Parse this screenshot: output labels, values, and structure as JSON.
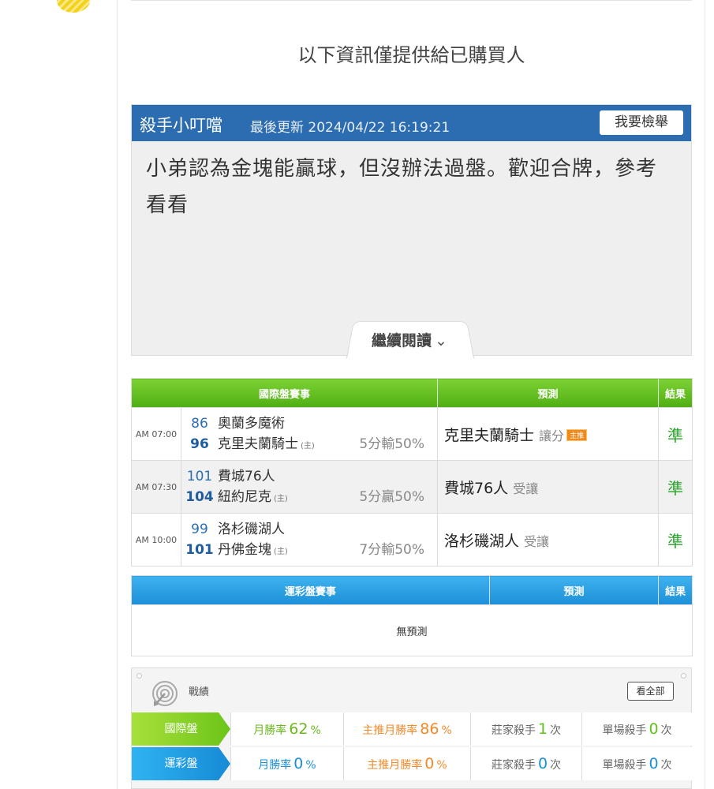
{
  "notice": "以下資訊僅提供給已購買人",
  "article": {
    "author": "殺手小叮噹",
    "updated": "最後更新 2024/04/22 16:19:21",
    "report_label": "我要檢舉",
    "body": "小弟認為金塊能贏球，但沒辦法過盤。歡迎合牌，參考看看",
    "read_more": "繼續閱讀"
  },
  "intl": {
    "headers": [
      "國際盤賽事",
      "預測",
      "結果"
    ],
    "home_mark": "(主)",
    "main_tag": "主推",
    "games": [
      {
        "time": "AM 07:00",
        "away_score": "86",
        "away": "奧蘭多魔術",
        "home_score": "96",
        "home": "克里夫蘭騎士",
        "spread": "5分輸50%",
        "pred_team": "克里夫蘭騎士",
        "pred_type": "讓分",
        "main": true,
        "result": "準"
      },
      {
        "time": "AM 07:30",
        "away_score": "101",
        "away": "費城76人",
        "home_score": "104",
        "home": "紐約尼克",
        "spread": "5分贏50%",
        "pred_team": "費城76人",
        "pred_type": "受讓",
        "main": false,
        "result": "準"
      },
      {
        "time": "AM 10:00",
        "away_score": "99",
        "away": "洛杉磯湖人",
        "home_score": "101",
        "home": "丹佛金塊",
        "spread": "7分輸50%",
        "pred_team": "洛杉磯湖人",
        "pred_type": "受讓",
        "main": false,
        "result": "準"
      }
    ]
  },
  "lottery": {
    "headers": [
      "運彩盤賽事",
      "預測",
      "結果"
    ],
    "empty": "無預測"
  },
  "record": {
    "title": "戰績",
    "view_all": "看全部",
    "rows": [
      {
        "label": "國際盤",
        "monthly_label": "月勝率",
        "monthly": "62",
        "main_label": "主推月勝率",
        "main": "86",
        "banker_label": "莊家殺手",
        "banker": "1",
        "single_label": "單場殺手",
        "single": "0",
        "pct": "%",
        "times": "次"
      },
      {
        "label": "運彩盤",
        "monthly_label": "月勝率",
        "monthly": "0",
        "main_label": "主推月勝率",
        "main": "0",
        "banker_label": "莊家殺手",
        "banker": "0",
        "single_label": "單場殺手",
        "single": "0",
        "pct": "%",
        "times": "次"
      }
    ]
  },
  "colors": {
    "header_blue": "#2c6cb0",
    "green": "#4fae14",
    "sky": "#1c8fd8",
    "orange": "#f08a2a"
  },
  "icons": [
    "target-icon",
    "chevron-down-icon"
  ]
}
